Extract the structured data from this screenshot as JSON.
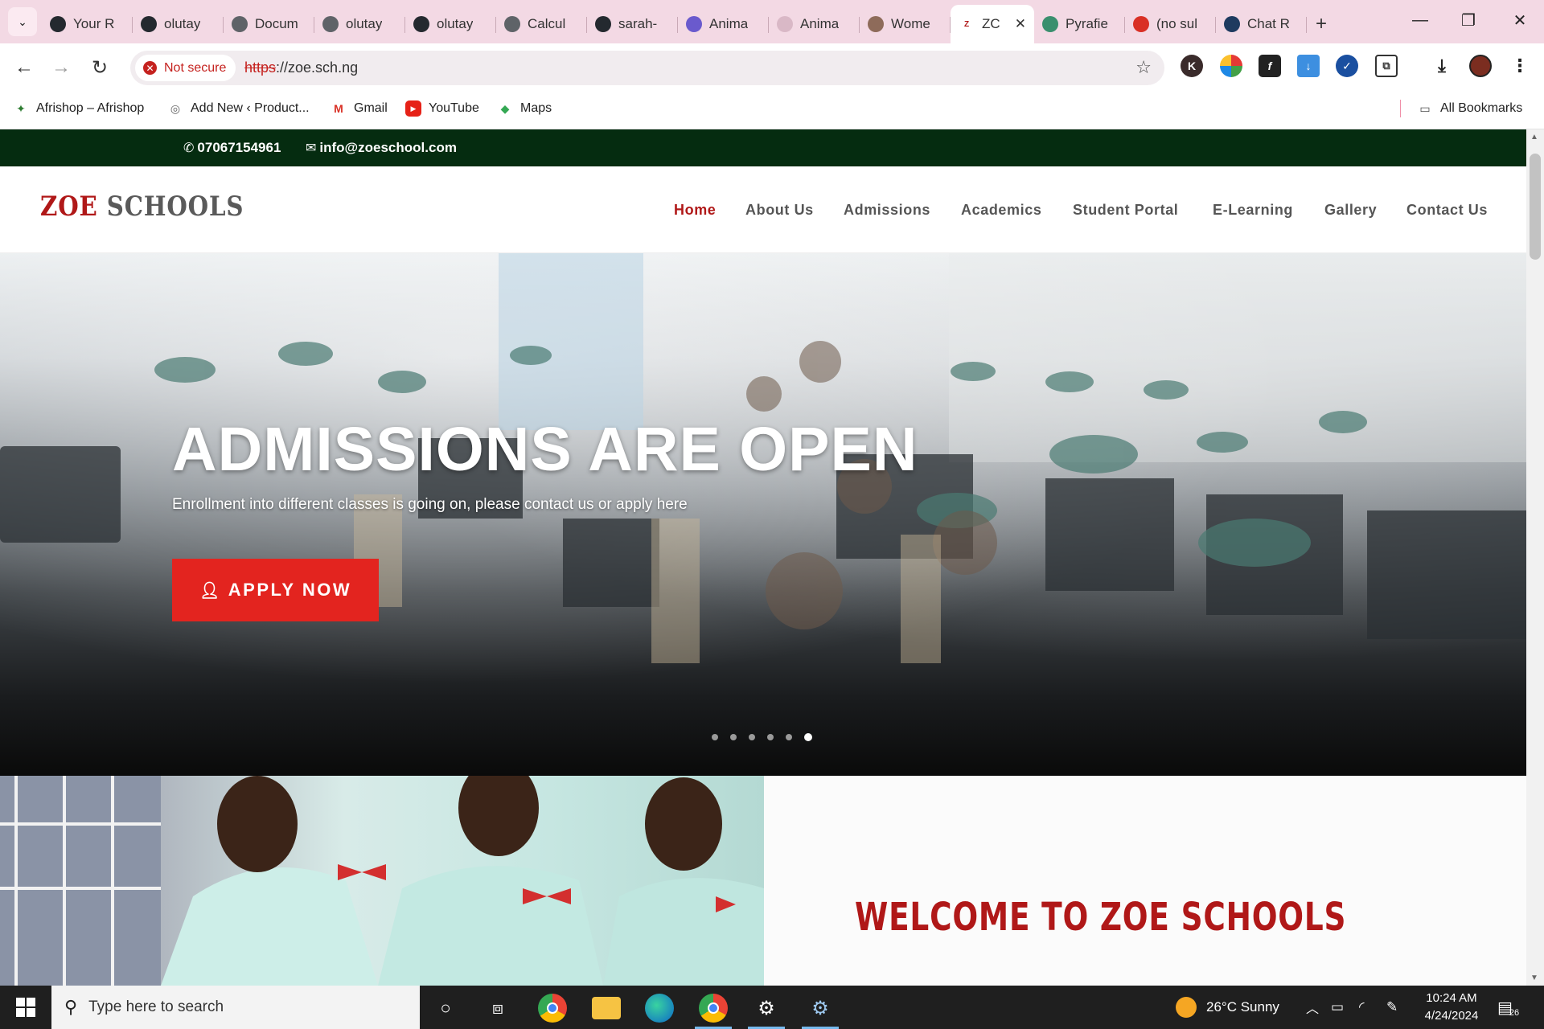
{
  "browser": {
    "tabs": [
      {
        "label": "Your R",
        "icon": "github-icon",
        "color": "#24292f"
      },
      {
        "label": "olutay",
        "icon": "github-icon",
        "color": "#24292f"
      },
      {
        "label": "Docum",
        "icon": "globe-icon",
        "color": "#5f6368"
      },
      {
        "label": "olutay",
        "icon": "globe-icon",
        "color": "#5f6368"
      },
      {
        "label": "olutay",
        "icon": "github-icon",
        "color": "#24292f"
      },
      {
        "label": "Calcul",
        "icon": "globe-icon",
        "color": "#5f6368"
      },
      {
        "label": "sarah-",
        "icon": "github-icon",
        "color": "#24292f"
      },
      {
        "label": "Anima",
        "icon": "animation-icon",
        "color": "#6a5acd"
      },
      {
        "label": "Anima",
        "icon": "loading-icon",
        "color": "#d9b8c6"
      },
      {
        "label": "Wome",
        "icon": "person-icon",
        "color": "#8e6b5a"
      }
    ],
    "active_tab": {
      "label": "ZC",
      "icon": "zoe-favicon",
      "close": "✕"
    },
    "tabs_after": [
      {
        "label": "Pyrafie",
        "icon": "pyrafie-icon",
        "color": "#3a8f6e"
      },
      {
        "label": "(no sul",
        "icon": "gmail-icon",
        "color": "#d93025"
      },
      {
        "label": "Chat R",
        "icon": "react-icon",
        "color": "#1e3a5f"
      }
    ],
    "new_tab": "+",
    "window_controls": {
      "minimize": "—",
      "restore": "❐",
      "close": "✕"
    },
    "security_label": "Not secure",
    "url_scheme": "https",
    "url_rest": "://zoe.sch.ng",
    "bookmarks": [
      {
        "label": "Afrishop – Afrishop",
        "icon": "afrishop-icon"
      },
      {
        "label": "Add New ‹ Product...",
        "icon": "wordpress-icon"
      },
      {
        "label": "Gmail",
        "icon": "gmail-icon"
      },
      {
        "label": "YouTube",
        "icon": "youtube-icon"
      },
      {
        "label": "Maps",
        "icon": "maps-icon"
      }
    ],
    "all_bookmarks": "All Bookmarks"
  },
  "site": {
    "phone": "07067154961",
    "email": "info@zoeschool.com",
    "logo_zoe": "ZOE",
    "logo_rest": " SCHOOLS",
    "nav": [
      "Home",
      "About Us",
      "Admissions",
      "Academics",
      "Student Portal",
      "E-Learning",
      "Gallery",
      "Contact Us"
    ],
    "hero": {
      "title": "ADMISSIONS ARE OPEN",
      "subtitle": "Enrollment into different classes is going on, please contact us or apply here",
      "button": "APPLY NOW",
      "slides_total": 6,
      "slide_active": 6
    },
    "welcome": "WELCOME TO ZOE SCHOOLS"
  },
  "taskbar": {
    "search_placeholder": "Type here to search",
    "weather": "26°C  Sunny",
    "time": "10:24 AM",
    "date": "4/24/2024",
    "notifications": "26"
  },
  "colors": {
    "brand_red": "#b01818",
    "apply_red": "#e3241f",
    "topbar_green": "#052c10",
    "tab_strip": "#f3d9e4"
  }
}
